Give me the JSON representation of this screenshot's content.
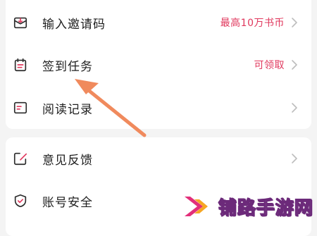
{
  "menu_group_1": {
    "items": [
      {
        "label": "输入邀请码",
        "value": "最高10万书币",
        "icon": "envelope-icon"
      },
      {
        "label": "签到任务",
        "value": "可领取",
        "icon": "calendar-icon"
      },
      {
        "label": "阅读记录",
        "value": "",
        "icon": "document-icon"
      }
    ]
  },
  "menu_group_2": {
    "items": [
      {
        "label": "意见反馈",
        "value": "",
        "icon": "edit-icon"
      },
      {
        "label": "账号安全",
        "value": "",
        "icon": "shield-icon"
      }
    ]
  },
  "annotation": {
    "arrow_color": "#f08a5d",
    "target": "签到任务"
  },
  "watermark": {
    "text": "铺路手游网",
    "logo": "chevron-logo",
    "colors": [
      "#e22f7a",
      "#f6a623"
    ]
  },
  "colors": {
    "accent": "#e0375c",
    "background": "#f4f4f4",
    "card": "#ffffff",
    "chevron": "#bdbdbd"
  }
}
